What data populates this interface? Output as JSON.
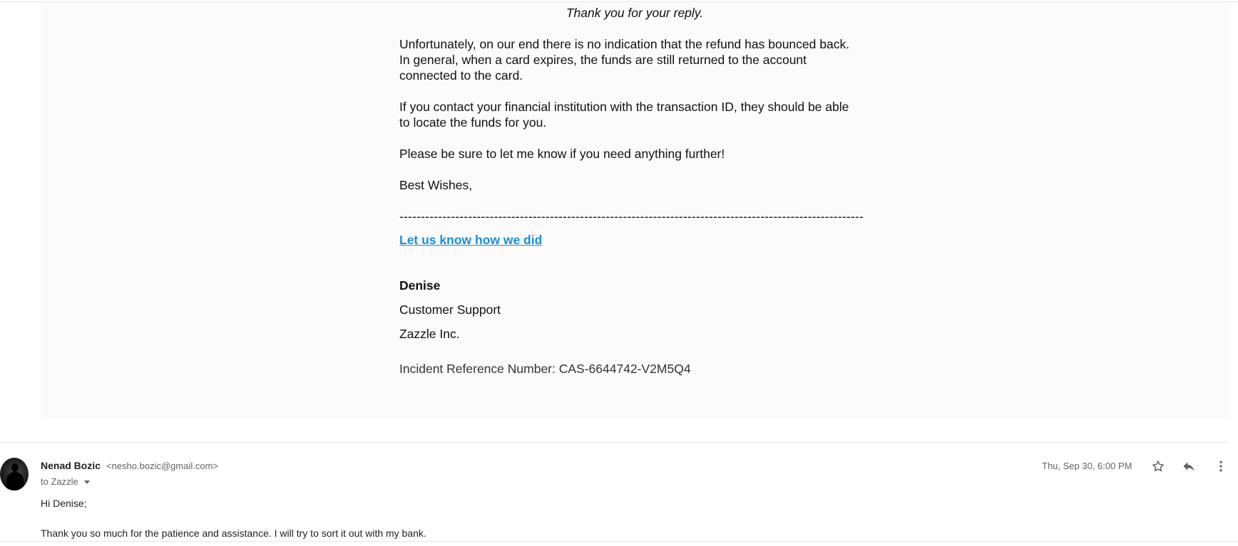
{
  "quoted_message": {
    "greeting": "Thank you for your reply.",
    "paragraphs": [
      "Unfortunately, on our end there is no indication that the refund has bounced back.\nIn general, when a card expires, the funds are still returned to the account\nconnected to the card.",
      "If you contact your financial institution with the transaction ID, they should be able\nto locate the funds for you.",
      "Please be sure to let me know if you need anything further!",
      "Best Wishes,"
    ],
    "separator": "------------------------------------------------------------------------------------------------------------",
    "feedback_link": "Let us know how we did",
    "signature": {
      "name": "Denise",
      "role": "Customer Support",
      "company": "Zazzle Inc."
    },
    "incident_reference": "Incident Reference Number: CAS-6644742-V2M5Q4"
  },
  "reply_message": {
    "sender_name": "Nenad Bozic",
    "sender_email": "<nesho.bozic@gmail.com>",
    "to_line": "to Zazzle",
    "date": "Thu, Sep 30, 6:00 PM",
    "lines": [
      "Hi Denise;",
      "Thank you so much for the patience and assistance. I will try to sort it out with my bank."
    ],
    "icons": {
      "star": "star-icon",
      "reply": "reply-icon",
      "more": "more-vertical-icon",
      "details": "chevron-down-icon"
    }
  },
  "colors": {
    "link": "#1a8fd6",
    "quoted_background": "#fbfbfb",
    "secondary_text": "#5f6368"
  }
}
